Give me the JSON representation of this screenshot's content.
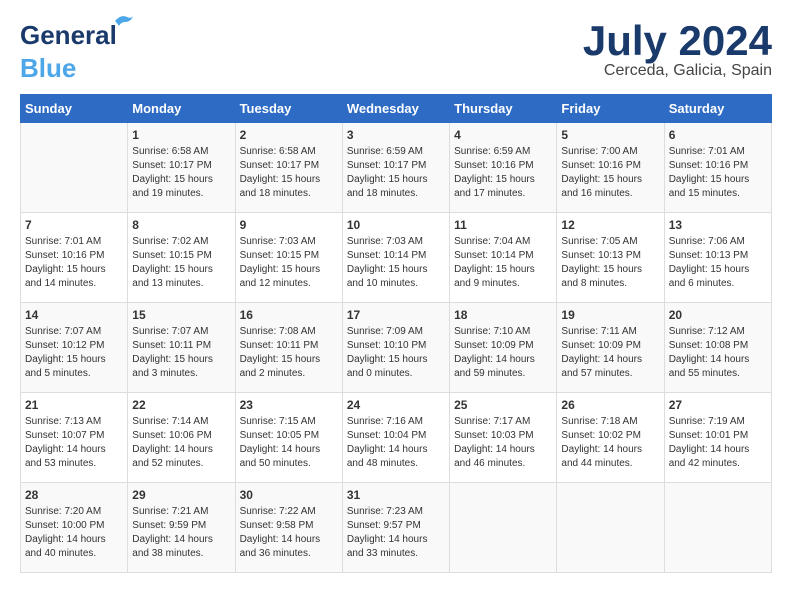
{
  "header": {
    "logo_general": "General",
    "logo_blue": "Blue",
    "month_title": "July 2024",
    "location": "Cerceda, Galicia, Spain"
  },
  "days_of_week": [
    "Sunday",
    "Monday",
    "Tuesday",
    "Wednesday",
    "Thursday",
    "Friday",
    "Saturday"
  ],
  "weeks": [
    [
      {
        "day": "",
        "content": ""
      },
      {
        "day": "1",
        "content": "Sunrise: 6:58 AM\nSunset: 10:17 PM\nDaylight: 15 hours\nand 19 minutes."
      },
      {
        "day": "2",
        "content": "Sunrise: 6:58 AM\nSunset: 10:17 PM\nDaylight: 15 hours\nand 18 minutes."
      },
      {
        "day": "3",
        "content": "Sunrise: 6:59 AM\nSunset: 10:17 PM\nDaylight: 15 hours\nand 18 minutes."
      },
      {
        "day": "4",
        "content": "Sunrise: 6:59 AM\nSunset: 10:16 PM\nDaylight: 15 hours\nand 17 minutes."
      },
      {
        "day": "5",
        "content": "Sunrise: 7:00 AM\nSunset: 10:16 PM\nDaylight: 15 hours\nand 16 minutes."
      },
      {
        "day": "6",
        "content": "Sunrise: 7:01 AM\nSunset: 10:16 PM\nDaylight: 15 hours\nand 15 minutes."
      }
    ],
    [
      {
        "day": "7",
        "content": "Sunrise: 7:01 AM\nSunset: 10:16 PM\nDaylight: 15 hours\nand 14 minutes."
      },
      {
        "day": "8",
        "content": "Sunrise: 7:02 AM\nSunset: 10:15 PM\nDaylight: 15 hours\nand 13 minutes."
      },
      {
        "day": "9",
        "content": "Sunrise: 7:03 AM\nSunset: 10:15 PM\nDaylight: 15 hours\nand 12 minutes."
      },
      {
        "day": "10",
        "content": "Sunrise: 7:03 AM\nSunset: 10:14 PM\nDaylight: 15 hours\nand 10 minutes."
      },
      {
        "day": "11",
        "content": "Sunrise: 7:04 AM\nSunset: 10:14 PM\nDaylight: 15 hours\nand 9 minutes."
      },
      {
        "day": "12",
        "content": "Sunrise: 7:05 AM\nSunset: 10:13 PM\nDaylight: 15 hours\nand 8 minutes."
      },
      {
        "day": "13",
        "content": "Sunrise: 7:06 AM\nSunset: 10:13 PM\nDaylight: 15 hours\nand 6 minutes."
      }
    ],
    [
      {
        "day": "14",
        "content": "Sunrise: 7:07 AM\nSunset: 10:12 PM\nDaylight: 15 hours\nand 5 minutes."
      },
      {
        "day": "15",
        "content": "Sunrise: 7:07 AM\nSunset: 10:11 PM\nDaylight: 15 hours\nand 3 minutes."
      },
      {
        "day": "16",
        "content": "Sunrise: 7:08 AM\nSunset: 10:11 PM\nDaylight: 15 hours\nand 2 minutes."
      },
      {
        "day": "17",
        "content": "Sunrise: 7:09 AM\nSunset: 10:10 PM\nDaylight: 15 hours\nand 0 minutes."
      },
      {
        "day": "18",
        "content": "Sunrise: 7:10 AM\nSunset: 10:09 PM\nDaylight: 14 hours\nand 59 minutes."
      },
      {
        "day": "19",
        "content": "Sunrise: 7:11 AM\nSunset: 10:09 PM\nDaylight: 14 hours\nand 57 minutes."
      },
      {
        "day": "20",
        "content": "Sunrise: 7:12 AM\nSunset: 10:08 PM\nDaylight: 14 hours\nand 55 minutes."
      }
    ],
    [
      {
        "day": "21",
        "content": "Sunrise: 7:13 AM\nSunset: 10:07 PM\nDaylight: 14 hours\nand 53 minutes."
      },
      {
        "day": "22",
        "content": "Sunrise: 7:14 AM\nSunset: 10:06 PM\nDaylight: 14 hours\nand 52 minutes."
      },
      {
        "day": "23",
        "content": "Sunrise: 7:15 AM\nSunset: 10:05 PM\nDaylight: 14 hours\nand 50 minutes."
      },
      {
        "day": "24",
        "content": "Sunrise: 7:16 AM\nSunset: 10:04 PM\nDaylight: 14 hours\nand 48 minutes."
      },
      {
        "day": "25",
        "content": "Sunrise: 7:17 AM\nSunset: 10:03 PM\nDaylight: 14 hours\nand 46 minutes."
      },
      {
        "day": "26",
        "content": "Sunrise: 7:18 AM\nSunset: 10:02 PM\nDaylight: 14 hours\nand 44 minutes."
      },
      {
        "day": "27",
        "content": "Sunrise: 7:19 AM\nSunset: 10:01 PM\nDaylight: 14 hours\nand 42 minutes."
      }
    ],
    [
      {
        "day": "28",
        "content": "Sunrise: 7:20 AM\nSunset: 10:00 PM\nDaylight: 14 hours\nand 40 minutes."
      },
      {
        "day": "29",
        "content": "Sunrise: 7:21 AM\nSunset: 9:59 PM\nDaylight: 14 hours\nand 38 minutes."
      },
      {
        "day": "30",
        "content": "Sunrise: 7:22 AM\nSunset: 9:58 PM\nDaylight: 14 hours\nand 36 minutes."
      },
      {
        "day": "31",
        "content": "Sunrise: 7:23 AM\nSunset: 9:57 PM\nDaylight: 14 hours\nand 33 minutes."
      },
      {
        "day": "",
        "content": ""
      },
      {
        "day": "",
        "content": ""
      },
      {
        "day": "",
        "content": ""
      }
    ]
  ]
}
